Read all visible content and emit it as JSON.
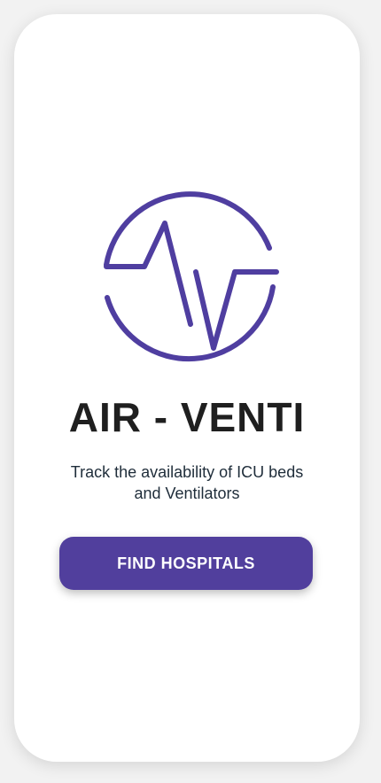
{
  "app": {
    "title": "AIR - VENTI",
    "tagline": "Track the availability of ICU beds and Ventilators",
    "logo_icon": "heartbeat-circle-icon",
    "accent_color": "#513f9d"
  },
  "actions": {
    "find_hospitals_label": "FIND HOSPITALS"
  }
}
